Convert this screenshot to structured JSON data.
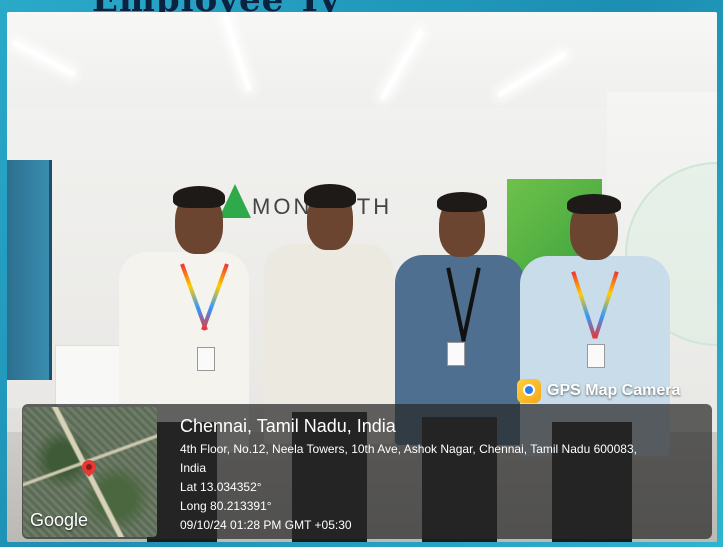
{
  "header": {
    "text": "Employee Ty"
  },
  "photo": {
    "signage": {
      "brand_text": "MONOLITH"
    }
  },
  "overlay": {
    "app_name": "GPS Map Camera",
    "map_brand": "Google",
    "location_title": "Chennai, Tamil Nadu, India",
    "address_line1": "4th Floor, No.12, Neela Towers, 10th Ave, Ashok Nagar, Chennai, Tamil Nadu 600083,",
    "address_line2": "India",
    "latitude": "Lat 13.034352°",
    "longitude": "Long 80.213391°",
    "timestamp": "09/10/24 01:28 PM GMT +05:30"
  },
  "colors": {
    "frame_background": "#1f9fbf",
    "logo_green": "#2faa4a",
    "panel_overlay": "rgba(40,40,40,0.72)"
  }
}
